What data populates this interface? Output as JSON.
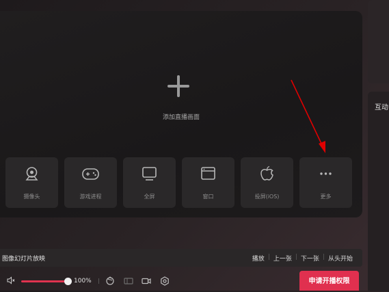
{
  "main": {
    "add_source_label": "添加直播画面",
    "sources": [
      {
        "label": "摄像头",
        "icon": "webcam-icon"
      },
      {
        "label": "游戏进程",
        "icon": "gamepad-icon"
      },
      {
        "label": "全屏",
        "icon": "monitor-icon"
      },
      {
        "label": "窗口",
        "icon": "window-icon"
      },
      {
        "label": "投屏(iOS)",
        "icon": "apple-icon"
      },
      {
        "label": "更多",
        "icon": "more-icon"
      }
    ]
  },
  "right_panel": {
    "title": "互动"
  },
  "slideshow": {
    "title": "图像幻灯片放映",
    "controls": {
      "play": "播放",
      "prev": "上一张",
      "next": "下一张",
      "restart": "从头开始"
    }
  },
  "bottom_bar": {
    "volume_percent": "100%",
    "volume_level": 1.0,
    "apply_button": "申请开播权限"
  },
  "colors": {
    "accent": "#e0304f",
    "annotation_arrow": "#e00000"
  }
}
